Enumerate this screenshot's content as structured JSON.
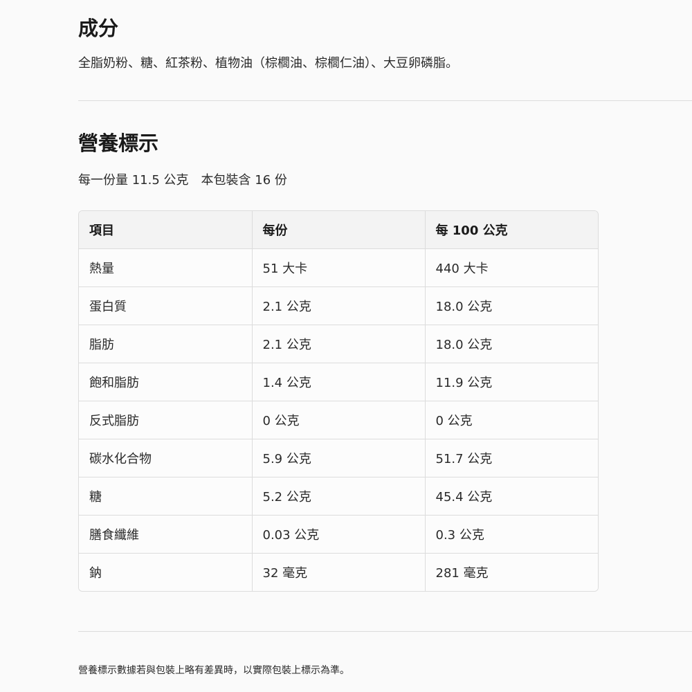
{
  "ingredients": {
    "title": "成分",
    "text": "全脂奶粉、糖、紅茶粉、植物油（棕櫚油、棕櫚仁油）、大豆卵磷脂。"
  },
  "nutrition": {
    "title": "營養標示",
    "serving_info": "每一份量 11.5 公克　本包裝含 16 份",
    "table": {
      "headers": [
        "項目",
        "每份",
        "每 100 公克"
      ],
      "rows": [
        [
          "熱量",
          "51 大卡",
          "440 大卡"
        ],
        [
          "蛋白質",
          "2.1 公克",
          "18.0 公克"
        ],
        [
          "脂肪",
          "2.1 公克",
          "18.0 公克"
        ],
        [
          "飽和脂肪",
          "1.4 公克",
          "11.9 公克"
        ],
        [
          "反式脂肪",
          "0 公克",
          "0 公克"
        ],
        [
          "碳水化合物",
          "5.9 公克",
          "51.7 公克"
        ],
        [
          "糖",
          "5.2 公克",
          "45.4 公克"
        ],
        [
          "膳食纖維",
          "0.03 公克",
          "0.3 公克"
        ],
        [
          "鈉",
          "32 毫克",
          "281 毫克"
        ]
      ]
    }
  },
  "footnote": "營養標示數據若與包裝上略有差異時，以實際包裝上標示為準。"
}
